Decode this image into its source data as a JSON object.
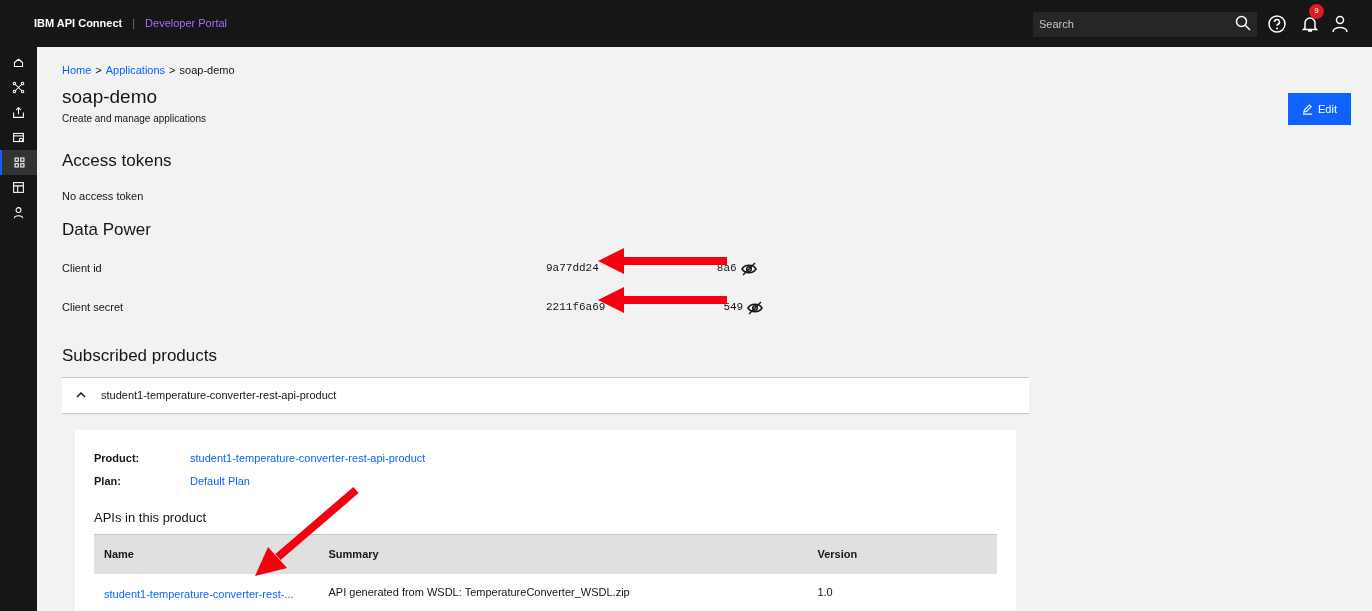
{
  "header": {
    "brand": "IBM API Connect",
    "separator": "|",
    "portal": "Developer Portal",
    "search": {
      "placeholder": "Search"
    },
    "notifications": "9"
  },
  "sidebar": {
    "items": [
      {
        "kind": "home",
        "selected": false
      },
      {
        "kind": "apis",
        "selected": false
      },
      {
        "kind": "upload",
        "selected": false
      },
      {
        "kind": "explore",
        "selected": false
      },
      {
        "kind": "apps",
        "selected": true
      },
      {
        "kind": "dashboard",
        "selected": false
      },
      {
        "kind": "user",
        "selected": false
      }
    ]
  },
  "breadcrumb": {
    "separator": ">",
    "items": [
      {
        "label": "Home",
        "link": true
      },
      {
        "label": "Applications",
        "link": true
      },
      {
        "label": "soap-demo",
        "link": false
      }
    ]
  },
  "title": "soap-demo",
  "subtitle": "Create and manage applications",
  "edit_button": "Edit",
  "access_tokens": {
    "heading": "Access tokens",
    "message": "No access token"
  },
  "data_power": {
    "heading": "Data Power",
    "fields": [
      {
        "label": "Client id",
        "value_start": "9a77dd24",
        "value_end": "8a6"
      },
      {
        "label": "Client secret",
        "value_start": "2211f6a69",
        "value_end": "549"
      }
    ]
  },
  "subscribed": {
    "heading": "Subscribed products",
    "product": {
      "name": "student1-temperature-converter-rest-api-product",
      "expanded": true,
      "details": [
        {
          "label": "Product:",
          "value": "student1-temperature-converter-rest-api-product"
        },
        {
          "label": "Plan:",
          "value": "Default Plan"
        }
      ],
      "apis_heading": "APIs in this product",
      "columns": [
        "Name",
        "Summary",
        "Version"
      ],
      "rows": [
        {
          "name": "student1-temperature-converter-rest-...",
          "summary": "API generated from WSDL: TemperatureConverter_WSDL.zip",
          "version": "1.0"
        }
      ]
    }
  }
}
